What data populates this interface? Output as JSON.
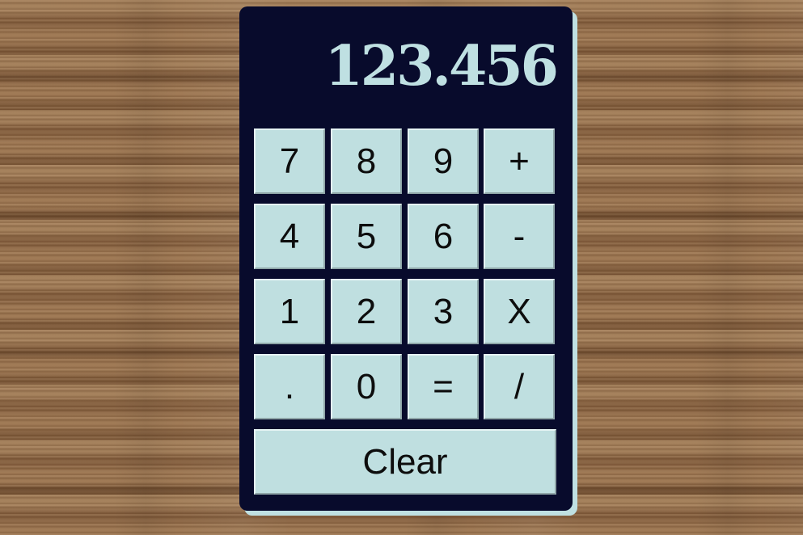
{
  "display": {
    "value": "123.456"
  },
  "keys": {
    "row1": [
      "7",
      "8",
      "9",
      "+"
    ],
    "row2": [
      "4",
      "5",
      "6",
      "-"
    ],
    "row3": [
      "1",
      "2",
      "3",
      "X"
    ],
    "row4": [
      ".",
      "0",
      "=",
      "/"
    ],
    "clear": "Clear"
  },
  "colors": {
    "calculator_body": "#080b2c",
    "display_text": "#bfe0e2",
    "key_face": "#bfdfe0",
    "key_text": "#0d0d0d",
    "background": "wood"
  }
}
